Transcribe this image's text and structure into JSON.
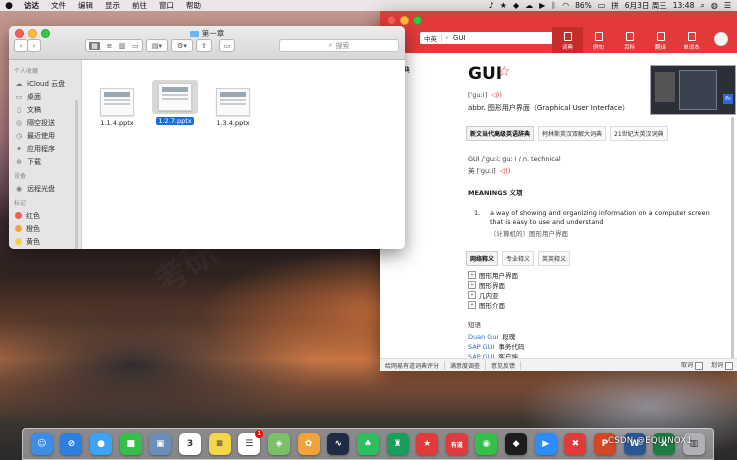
{
  "menubar": {
    "apple": "",
    "items": [
      "访达",
      "文件",
      "编辑",
      "显示",
      "前往",
      "窗口",
      "帮助"
    ],
    "battery": "86%",
    "input": "拼",
    "date": "6月3日 周三",
    "time": "13:48"
  },
  "finder": {
    "title": "第一章",
    "search_placeholder": "搜索",
    "sidebar": {
      "sections": [
        {
          "header": "个人收藏",
          "items": [
            {
              "label": "iCloud 云盘",
              "icon": "cloud-icon"
            },
            {
              "label": "桌面",
              "icon": "desktop-icon"
            },
            {
              "label": "文稿",
              "icon": "document-icon"
            },
            {
              "label": "隔空投送",
              "icon": "airdrop-icon"
            },
            {
              "label": "最近使用",
              "icon": "clock-icon"
            },
            {
              "label": "应用程序",
              "icon": "apps-icon"
            },
            {
              "label": "下载",
              "icon": "download-icon"
            }
          ]
        },
        {
          "header": "设备",
          "items": [
            {
              "label": "远程光盘",
              "icon": "disc-icon"
            }
          ]
        },
        {
          "header": "标记",
          "items": [
            {
              "label": "红色",
              "color": "#f45b53"
            },
            {
              "label": "橙色",
              "color": "#f5a23a"
            },
            {
              "label": "黄色",
              "color": "#f2d33e"
            },
            {
              "label": "绿色",
              "color": "#52c24a"
            }
          ]
        }
      ]
    },
    "files": [
      {
        "name": "1.1.4.pptx",
        "selected": false
      },
      {
        "name": "1.2.7.pptx",
        "selected": true
      },
      {
        "name": "1.3.4.pptx",
        "selected": false
      }
    ]
  },
  "dict": {
    "search_lang": "中英",
    "query": "GUI",
    "nav": [
      {
        "label": "词典",
        "active": true
      },
      {
        "label": "例句",
        "active": false
      },
      {
        "label": "百科",
        "active": false
      },
      {
        "label": "翻译",
        "active": false
      },
      {
        "label": "单词本",
        "active": false
      }
    ],
    "leftnav": [
      "藏词典",
      "义",
      "句",
      "科"
    ],
    "word": "GUI",
    "phonetic": "['guːi]",
    "abbr": "abbr. 图形用户界面（Graphical User Interface）",
    "source_tabs": [
      {
        "label": "新文当代高级英语辞典",
        "active": true
      },
      {
        "label": "柯林斯英汉双解大词典",
        "active": false
      },
      {
        "label": "21世纪大英汉词典",
        "active": false
      }
    ],
    "def_line1": "GUI /ˈɡuːi; ɡuː i /    n.    technical",
    "def_line2": "英 ['guːi]",
    "meanings_header": "MEANINGS 义项",
    "meaning_number": "1.",
    "meaning_text": "a way of showing and organizing information on a computer screen that is easy to use and understand",
    "meaning_cn": "〔计算机的〕图形用户界面",
    "net_tabs": [
      {
        "label": "网络释义",
        "active": true
      },
      {
        "label": "专业释义",
        "active": false
      },
      {
        "label": "英英释义",
        "active": false
      }
    ],
    "net_items": [
      "图形用户界面",
      "图形界面",
      "几内亚",
      "图形介面"
    ],
    "phrase_header": "短语",
    "phrases": [
      {
        "en": "Duan Gui",
        "cn": "段瑰"
      },
      {
        "en": "SAP GUI",
        "cn": "事务代码"
      },
      {
        "en": "SAP GUI",
        "cn": "客户端"
      }
    ],
    "bottom_links": [
      "给网易有道词典评分",
      "满意度调查",
      "意见反馈"
    ],
    "bottom_right": [
      "取词",
      "划词"
    ]
  },
  "dock": {
    "icons": [
      {
        "name": "finder-icon",
        "color": "#3a8ee6",
        "glyph": "☺"
      },
      {
        "name": "safari-icon",
        "color": "#2f7fe3",
        "glyph": "⊘"
      },
      {
        "name": "messages-icon",
        "color": "#3da3f5",
        "glyph": "●"
      },
      {
        "name": "facetime-icon",
        "color": "#35c04a",
        "glyph": "■"
      },
      {
        "name": "preview-icon",
        "color": "#6b8fb8",
        "glyph": "▣"
      },
      {
        "name": "calendar-icon",
        "color": "#ffffff",
        "glyph": "3"
      },
      {
        "name": "notes-icon",
        "color": "#f5d54a",
        "glyph": "≡"
      },
      {
        "name": "reminders-icon",
        "color": "#ffffff",
        "glyph": "☰",
        "badge": "1"
      },
      {
        "name": "maps-icon",
        "color": "#7cbf6a",
        "glyph": "◈"
      },
      {
        "name": "photos-icon",
        "color": "#f0a33b",
        "glyph": "✿"
      },
      {
        "name": "activity-icon",
        "color": "#1f2b44",
        "glyph": "∿"
      },
      {
        "name": "evernote-icon",
        "color": "#2dbe60",
        "glyph": "♠"
      },
      {
        "name": "pycharm-icon",
        "color": "#18a05a",
        "glyph": "♜"
      },
      {
        "name": "bookmark-icon",
        "color": "#e23a3a",
        "glyph": "★"
      },
      {
        "name": "youdao-icon",
        "color": "#e23a3a",
        "glyph": "有道"
      },
      {
        "name": "wechat-icon",
        "color": "#35c04a",
        "glyph": "◉"
      },
      {
        "name": "qq-icon",
        "color": "#1d1d1d",
        "glyph": "◆"
      },
      {
        "name": "zoom-icon",
        "color": "#2d8cff",
        "glyph": "▶"
      },
      {
        "name": "xmind-icon",
        "color": "#e23a3a",
        "glyph": "✖"
      },
      {
        "name": "powerpoint-icon",
        "color": "#d24726",
        "glyph": "P"
      },
      {
        "name": "word-icon",
        "color": "#2b5797",
        "glyph": "W"
      },
      {
        "name": "excel-icon",
        "color": "#1d7c43",
        "glyph": "X"
      },
      {
        "name": "trash-icon",
        "color": "#b0b0b5",
        "glyph": "▥"
      }
    ],
    "overlay_label": "CSDN @EQUINOX1"
  },
  "colors": {
    "youdao_red": "#e23a3a",
    "selection_blue": "#1b6ce8"
  }
}
